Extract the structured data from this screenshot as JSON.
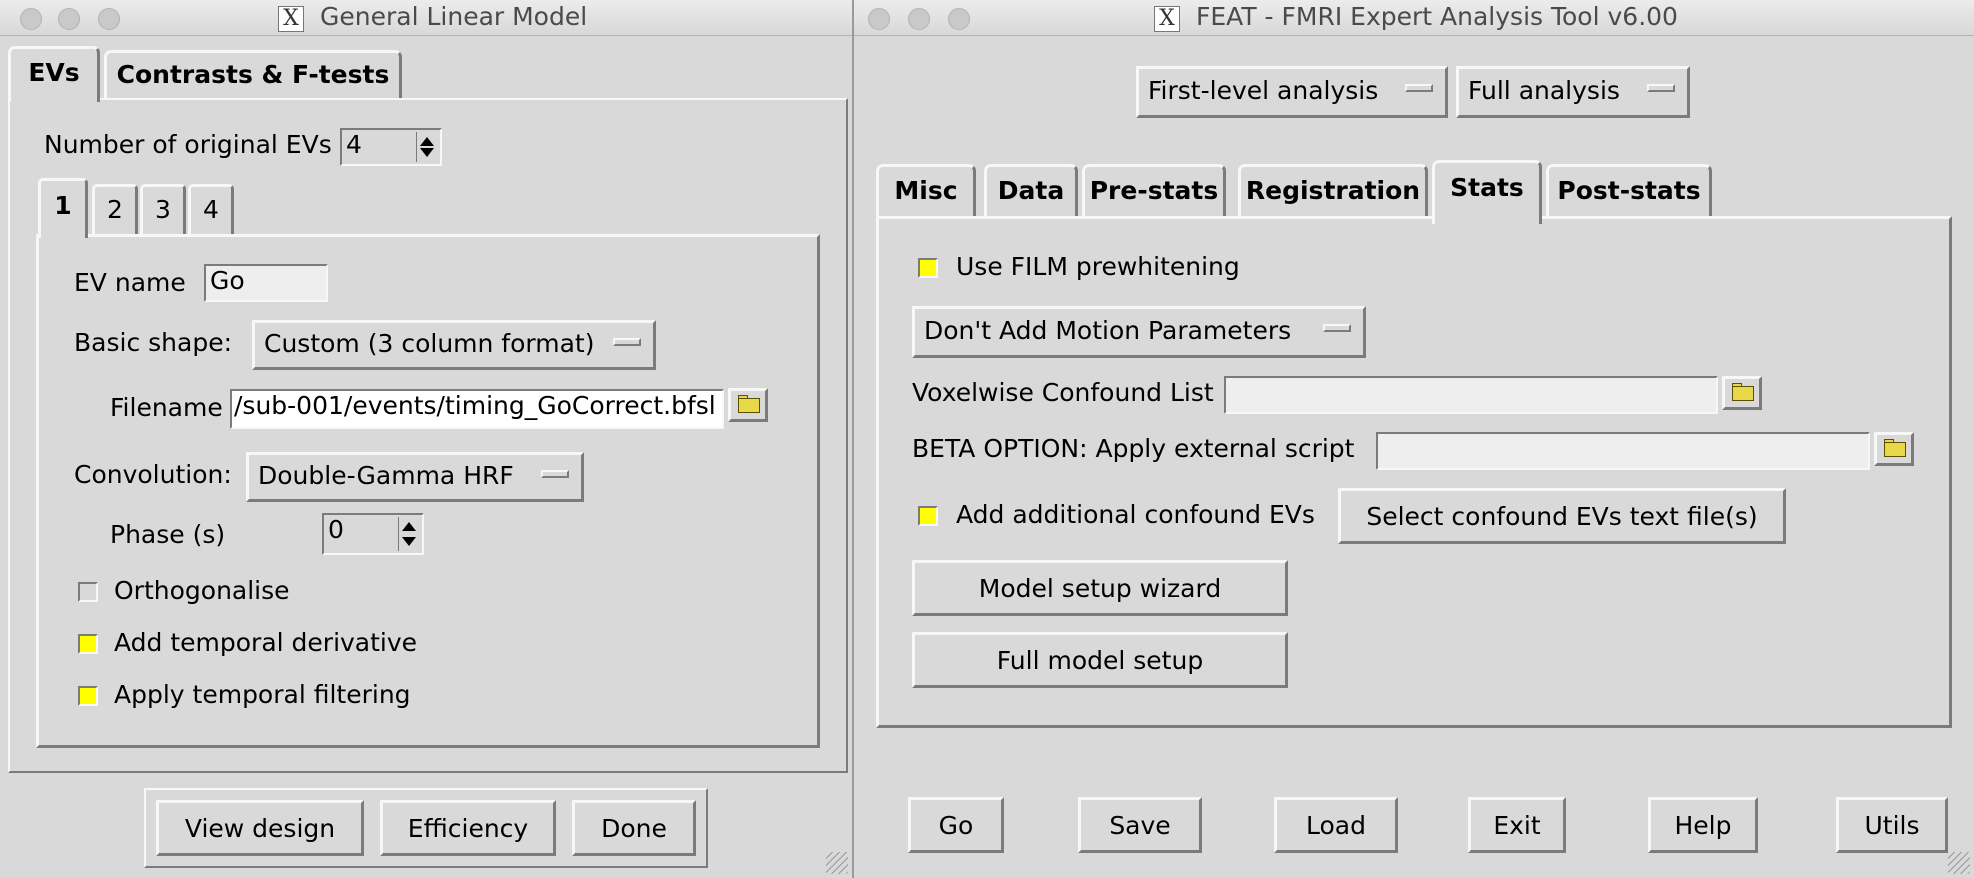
{
  "glm": {
    "title": "General Linear Model",
    "tabs": [
      "EVs",
      "Contrasts & F-tests"
    ],
    "num_evs_label": "Number of original EVs",
    "num_evs_value": "4",
    "ev_tabs": [
      "1",
      "2",
      "3",
      "4"
    ],
    "ev_name_label": "EV name",
    "ev_name_value": "Go",
    "basic_shape_label": "Basic shape:",
    "basic_shape_value": "Custom (3 column format)",
    "filename_label": "Filename",
    "filename_value": "/sub-001/events/timing_GoCorrect.bfsl",
    "convolution_label": "Convolution:",
    "convolution_value": "Double-Gamma HRF",
    "phase_label": "Phase (s)",
    "phase_value": "0",
    "orthogonalise_label": "Orthogonalise",
    "orthogonalise_checked": false,
    "temporal_derivative_label": "Add temporal derivative",
    "temporal_derivative_checked": true,
    "temporal_filtering_label": "Apply temporal filtering",
    "temporal_filtering_checked": true,
    "buttons": {
      "view_design": "View design",
      "efficiency": "Efficiency",
      "done": "Done"
    }
  },
  "feat": {
    "title": "FEAT - FMRI Expert Analysis Tool v6.00",
    "analysis_level": "First-level analysis",
    "analysis_type": "Full analysis",
    "tabs": [
      "Misc",
      "Data",
      "Pre-stats",
      "Registration",
      "Stats",
      "Post-stats"
    ],
    "selected_tab": "Stats",
    "film_label": "Use FILM prewhitening",
    "film_checked": true,
    "motion_menu": "Don't Add Motion Parameters",
    "voxelwise_label": "Voxelwise Confound List",
    "voxelwise_value": "",
    "beta_label": "BETA OPTION: Apply external script",
    "beta_value": "",
    "confound_label": "Add additional confound EVs",
    "confound_checked": true,
    "select_confound_button": "Select confound EVs text file(s)",
    "model_wizard_button": "Model setup wizard",
    "full_model_button": "Full model setup",
    "bottom_buttons": {
      "go": "Go",
      "save": "Save",
      "load": "Load",
      "exit": "Exit",
      "help": "Help",
      "utils": "Utils"
    }
  }
}
